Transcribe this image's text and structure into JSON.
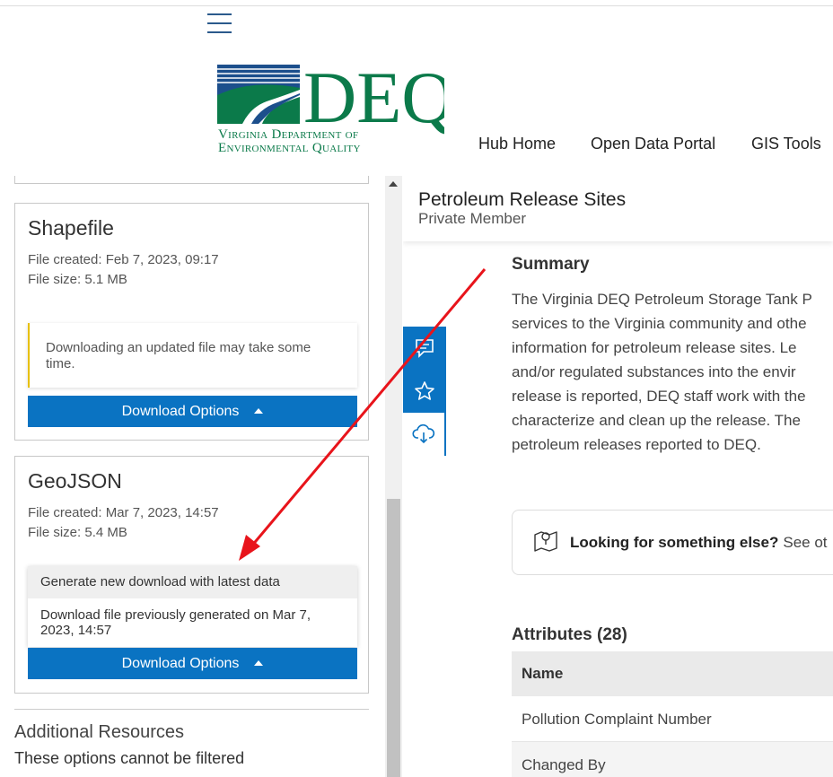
{
  "header": {
    "logo": {
      "title": "DEQ",
      "line1": "Virginia Department of",
      "line2": "Environmental Quality"
    },
    "nav": [
      "Hub Home",
      "Open Data Portal",
      "GIS Tools"
    ]
  },
  "downloads": {
    "shapefile": {
      "title": "Shapefile",
      "created": "File created: Feb 7, 2023, 09:17",
      "size": "File size: 5.1 MB",
      "notice": "Downloading an updated file may take some time.",
      "button": "Download Options"
    },
    "geojson": {
      "title": "GeoJSON",
      "created": "File created: Mar 7, 2023, 14:57",
      "size": "File size: 5.4 MB",
      "menu": [
        "Generate new download with latest data",
        "Download file previously generated on Mar 7, 2023, 14:57"
      ],
      "button": "Download Options"
    },
    "additional": {
      "title": "Additional Resources",
      "subtitle": "These options cannot be filtered"
    }
  },
  "dataset": {
    "title": "Petroleum Release Sites",
    "subtitle": "Private Member",
    "summary_heading": "Summary",
    "summary_lines": [
      "The Virginia DEQ Petroleum Storage Tank P",
      "services to the Virginia community and othe",
      "information for petroleum release sites. Le",
      "and/or regulated substances into the envir",
      "release is reported, DEQ staff work with the",
      "characterize and clean up the release. The",
      "petroleum releases reported to DEQ."
    ],
    "looking_bold": "Looking for something else?",
    "looking_rest": "See ot",
    "attributes_heading": "Attributes (28)",
    "table_header": "Name",
    "rows": [
      "Pollution Complaint Number",
      "Changed By"
    ]
  },
  "side_icons": [
    "comment-icon",
    "star-icon",
    "cloud-download-icon"
  ],
  "colors": {
    "accent": "#0a73c2",
    "deq_green": "#0b7a4a",
    "deq_blue": "#1c4f8c",
    "notice_border": "#e7c000",
    "annotation_arrow": "#e8141b"
  }
}
